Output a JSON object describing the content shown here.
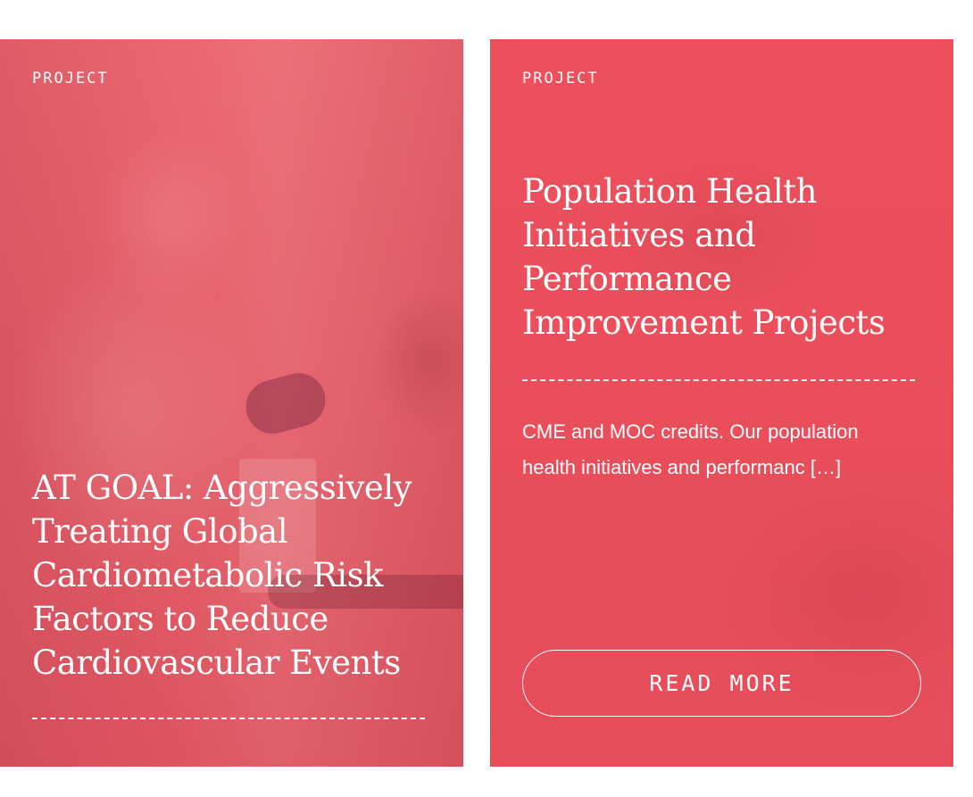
{
  "cards": [
    {
      "label": "PROJECT",
      "title": "AT GOAL: Aggressively Treating Global Cardiometabolic Risk Factors to Reduce Cardiovascular Events"
    },
    {
      "label": "PROJECT",
      "title": "Population Health Initiatives and Performance Improvement Projects",
      "excerpt": "CME and MOC credits. Our population health initiatives and performanc […]",
      "button_label": "READ MORE"
    }
  ],
  "colors": {
    "card_left_tint": "#ea5f69",
    "card_right_tint": "#ec505c",
    "text": "#ffffff"
  }
}
